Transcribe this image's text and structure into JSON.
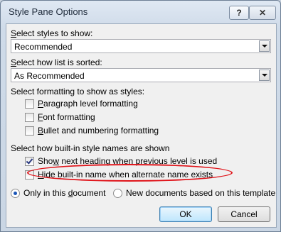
{
  "window": {
    "title": "Style Pane Options"
  },
  "titlebar": {
    "help_glyph": "?",
    "close_glyph": "✕"
  },
  "styles_to_show": {
    "label_prefix": "S",
    "label_rest": "elect styles to show:",
    "value": "Recommended"
  },
  "list_sort": {
    "label_prefix": "S",
    "label_rest": "elect how list is sorted:",
    "value": "As Recommended"
  },
  "formatting": {
    "label": "Select formatting to show as styles:",
    "options": [
      {
        "key": "P",
        "rest": "aragraph level formatting",
        "checked": false
      },
      {
        "key": "F",
        "rest": "ont formatting",
        "checked": false
      },
      {
        "key": "B",
        "rest": "ullet and numbering formatting",
        "checked": false
      }
    ]
  },
  "builtin_names": {
    "label": "Select how built-in style names are shown",
    "options": [
      {
        "pre": "Sho",
        "key": "w",
        "rest": " next heading when previous level is used",
        "checked": true
      },
      {
        "pre": "",
        "key": "H",
        "rest": "ide built-in name when alternate name exists",
        "checked": false
      }
    ]
  },
  "scope": {
    "options": [
      {
        "pre": "Only in this ",
        "key": "d",
        "rest": "ocument",
        "selected": true
      },
      {
        "pre": "New documents based on this template",
        "key": "",
        "rest": "",
        "selected": false
      }
    ]
  },
  "buttons": {
    "ok": "OK",
    "cancel": "Cancel"
  },
  "colors": {
    "highlight": "#e0141a",
    "accent": "#1a55b6"
  }
}
